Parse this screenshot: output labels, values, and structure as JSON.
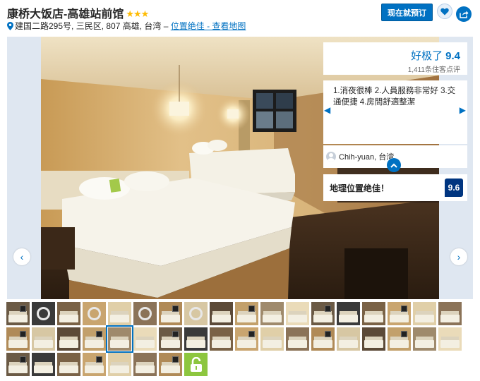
{
  "hotel": {
    "name": "康桥大饭店-高雄站前馆",
    "stars": "★★★",
    "address": "建国二路295号, 三民区, 807 高雄, 台湾",
    "address_sep": " – ",
    "location_link": "位置绝佳 - 查看地图"
  },
  "actions": {
    "book_label": "现在就预订",
    "favorite_icon": "heart-icon",
    "share_icon": "share-icon"
  },
  "review": {
    "label": "好极了",
    "score": "9.4",
    "count": "1,411条住客点评",
    "quote": "1.消夜很棒 2.人員服務非常好 3.交通便捷 4.房間舒適整潔",
    "author": "Chih-yuan, 台湾"
  },
  "location_rating": {
    "label": "地理位置绝佳！",
    "score": "9.6"
  },
  "gallery": {
    "prev_glyph": "‹",
    "next_glyph": "›",
    "quote_prev_glyph": "◀",
    "quote_next_glyph": "▶"
  },
  "thumbnails": {
    "count": 44,
    "selected_index": 22,
    "locked_icon": "unlock-icon"
  },
  "colors": {
    "brand_blue": "#0071c2",
    "score_navy": "#003580",
    "star_yellow": "#febb02",
    "lock_green": "#8dc63f"
  }
}
